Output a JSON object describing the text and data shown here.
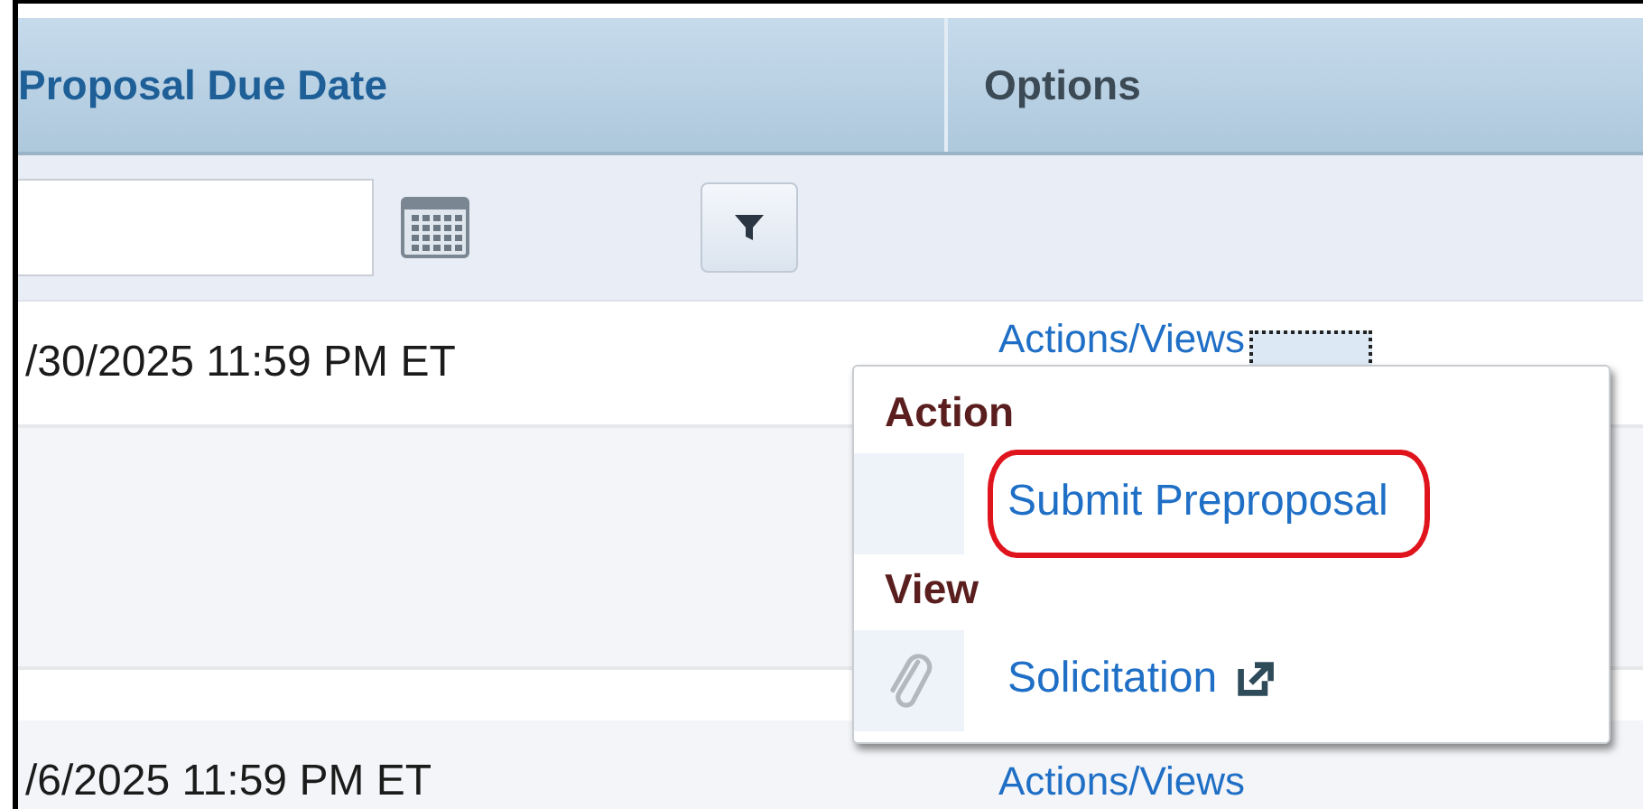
{
  "columns": [
    {
      "label": "Proposal Due Date"
    },
    {
      "label": "Options"
    }
  ],
  "rows": [
    {
      "kind": "entry",
      "due_date": "/30/2025 11:59 PM ET",
      "options_link": "Actions/Views"
    },
    {
      "kind": "blank"
    },
    {
      "kind": "entry",
      "due_date": "/6/2025 11:59 PM ET",
      "options_link": "Actions/Views"
    }
  ],
  "menu": {
    "sections": [
      {
        "heading": "Action",
        "items": [
          {
            "kind": "plain",
            "label": "Submit Preproposal",
            "external": false,
            "highlighted": true
          }
        ]
      },
      {
        "heading": "View",
        "items": [
          {
            "kind": "attachment",
            "label": "Solicitation",
            "external": true,
            "highlighted": false
          }
        ]
      }
    ]
  }
}
